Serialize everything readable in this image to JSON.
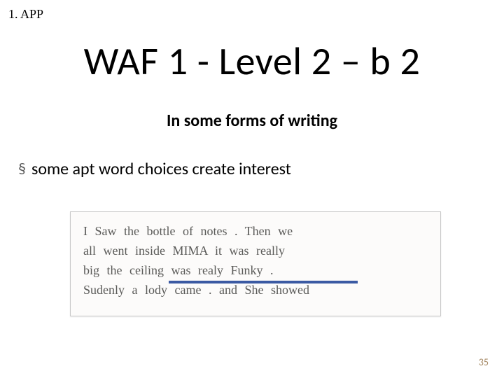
{
  "header": {
    "label": "1. APP"
  },
  "title": "WAF 1 - Level 2 – b 2",
  "subtitle": "In some forms of writing",
  "bullet": {
    "mark": "§",
    "text": "some apt word choices create interest"
  },
  "handwriting": {
    "line1": "I  Saw   the   bottle  of  notes .   Then  we",
    "line2": "all  went  inside  MIMA   it  was  really",
    "line3": "big  the  ceiling  was   realy   Funky .",
    "line4": "Sudenly   a   lody   came .   and  She   showed"
  },
  "page_number": "35"
}
